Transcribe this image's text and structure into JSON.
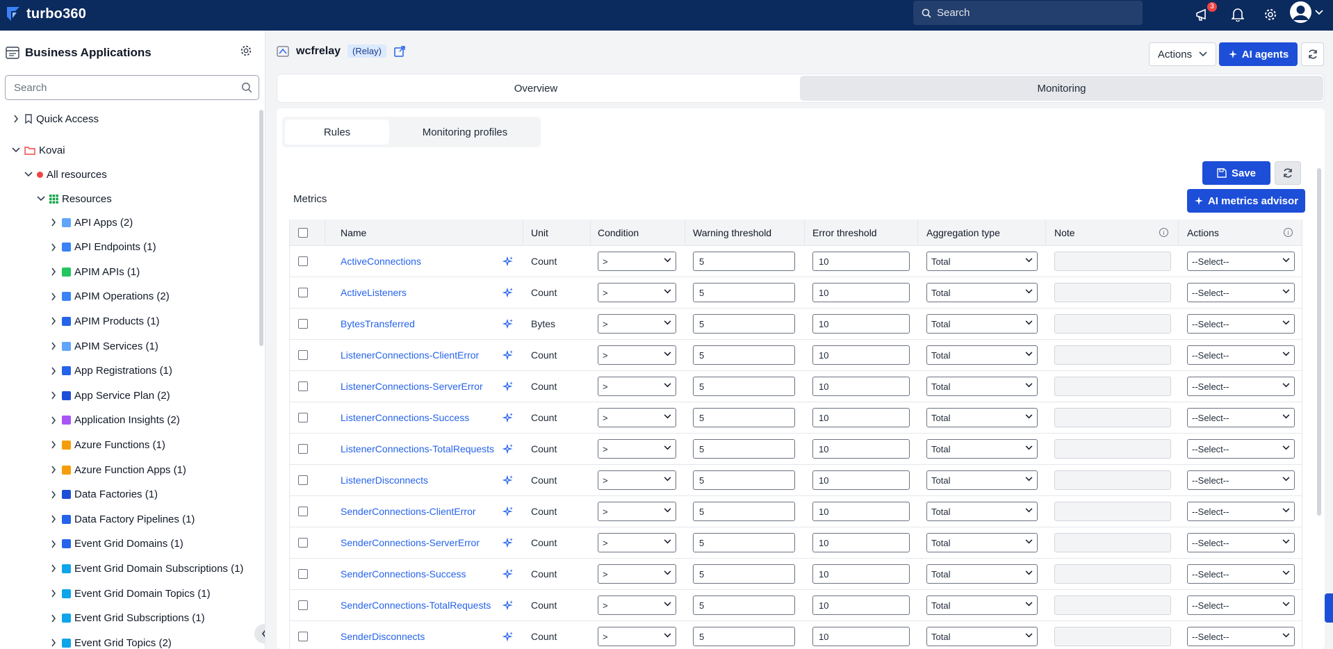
{
  "app": {
    "brand": "turbo360",
    "notifications_count": "3"
  },
  "top_search": {
    "placeholder": "Search"
  },
  "sidebar": {
    "title": "Business Applications",
    "search_placeholder": "Search",
    "items": [
      {
        "label": "Quick Access"
      },
      {
        "label": "Kovai"
      },
      {
        "label": "All resources"
      },
      {
        "label": "Resources"
      },
      {
        "label": "API Apps (2)"
      },
      {
        "label": "API Endpoints (1)"
      },
      {
        "label": "APIM APIs (1)"
      },
      {
        "label": "APIM Operations (2)"
      },
      {
        "label": "APIM Products (1)"
      },
      {
        "label": "APIM Services (1)"
      },
      {
        "label": "App Registrations (1)"
      },
      {
        "label": "App Service Plan (2)"
      },
      {
        "label": "Application Insights (2)"
      },
      {
        "label": "Azure Functions (1)"
      },
      {
        "label": "Azure Function Apps (1)"
      },
      {
        "label": "Data Factories (1)"
      },
      {
        "label": "Data Factory Pipelines (1)"
      },
      {
        "label": "Event Grid Domains (1)"
      },
      {
        "label": "Event Grid Domain Subscriptions (1)"
      },
      {
        "label": "Event Grid Domain Topics (1)"
      },
      {
        "label": "Event Grid Subscriptions (1)"
      },
      {
        "label": "Event Grid Topics (2)"
      }
    ]
  },
  "resource": {
    "name": "wcfrelay",
    "type": "(Relay)"
  },
  "header": {
    "actions_label": "Actions",
    "ai_agents_label": "AI agents"
  },
  "tabs": {
    "overview": "Overview",
    "monitoring": "Monitoring"
  },
  "subtabs": {
    "rules": "Rules",
    "profiles": "Monitoring profiles"
  },
  "toolbar": {
    "save_label": "Save",
    "metrics_label": "Metrics",
    "ai_metrics_label": "AI metrics advisor"
  },
  "table": {
    "columns": [
      "Name",
      "Unit",
      "Condition",
      "Warning threshold",
      "Error threshold",
      "Aggregation type",
      "Note",
      "Actions"
    ],
    "rows": [
      {
        "name": "ActiveConnections",
        "unit": "Count",
        "condition": ">",
        "warning": "5",
        "error": "10",
        "aggregation": "Total",
        "action": "--Select--"
      },
      {
        "name": "ActiveListeners",
        "unit": "Count",
        "condition": ">",
        "warning": "5",
        "error": "10",
        "aggregation": "Total",
        "action": "--Select--"
      },
      {
        "name": "BytesTransferred",
        "unit": "Bytes",
        "condition": ">",
        "warning": "5",
        "error": "10",
        "aggregation": "Total",
        "action": "--Select--"
      },
      {
        "name": "ListenerConnections-ClientError",
        "unit": "Count",
        "condition": ">",
        "warning": "5",
        "error": "10",
        "aggregation": "Total",
        "action": "--Select--"
      },
      {
        "name": "ListenerConnections-ServerError",
        "unit": "Count",
        "condition": ">",
        "warning": "5",
        "error": "10",
        "aggregation": "Total",
        "action": "--Select--"
      },
      {
        "name": "ListenerConnections-Success",
        "unit": "Count",
        "condition": ">",
        "warning": "5",
        "error": "10",
        "aggregation": "Total",
        "action": "--Select--"
      },
      {
        "name": "ListenerConnections-TotalRequests",
        "unit": "Count",
        "condition": ">",
        "warning": "5",
        "error": "10",
        "aggregation": "Total",
        "action": "--Select--"
      },
      {
        "name": "ListenerDisconnects",
        "unit": "Count",
        "condition": ">",
        "warning": "5",
        "error": "10",
        "aggregation": "Total",
        "action": "--Select--"
      },
      {
        "name": "SenderConnections-ClientError",
        "unit": "Count",
        "condition": ">",
        "warning": "5",
        "error": "10",
        "aggregation": "Total",
        "action": "--Select--"
      },
      {
        "name": "SenderConnections-ServerError",
        "unit": "Count",
        "condition": ">",
        "warning": "5",
        "error": "10",
        "aggregation": "Total",
        "action": "--Select--"
      },
      {
        "name": "SenderConnections-Success",
        "unit": "Count",
        "condition": ">",
        "warning": "5",
        "error": "10",
        "aggregation": "Total",
        "action": "--Select--"
      },
      {
        "name": "SenderConnections-TotalRequests",
        "unit": "Count",
        "condition": ">",
        "warning": "5",
        "error": "10",
        "aggregation": "Total",
        "action": "--Select--"
      },
      {
        "name": "SenderDisconnects",
        "unit": "Count",
        "condition": ">",
        "warning": "5",
        "error": "10",
        "aggregation": "Total",
        "action": "--Select--"
      }
    ]
  }
}
